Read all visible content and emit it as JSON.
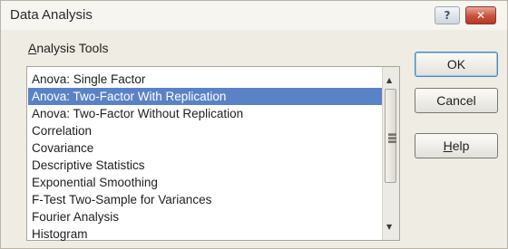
{
  "window": {
    "title": "Data Analysis",
    "help_glyph": "?",
    "close_glyph": "✕"
  },
  "analysis_tools": {
    "label_first": "A",
    "label_rest": "nalysis Tools",
    "items": [
      {
        "label": "Anova: Single Factor"
      },
      {
        "label": "Anova: Two-Factor With Replication",
        "selected": true
      },
      {
        "label": "Anova: Two-Factor Without Replication"
      },
      {
        "label": "Correlation"
      },
      {
        "label": "Covariance"
      },
      {
        "label": "Descriptive Statistics"
      },
      {
        "label": "Exponential Smoothing"
      },
      {
        "label": "F-Test Two-Sample for Variances"
      },
      {
        "label": "Fourier Analysis"
      },
      {
        "label": "Histogram"
      }
    ],
    "scroll_up_glyph": "▲",
    "scroll_down_glyph": "▼"
  },
  "buttons": {
    "ok": "OK",
    "cancel": "Cancel",
    "help_first": "H",
    "help_rest": "elp"
  }
}
